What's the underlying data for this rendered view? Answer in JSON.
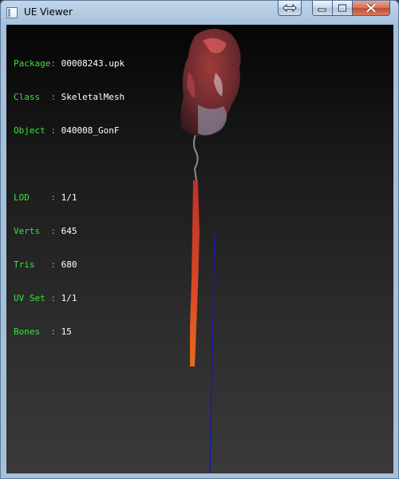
{
  "window": {
    "title": "UE Viewer",
    "icon": "app-window-icon",
    "controls": [
      "swap-icon",
      "minimize-icon",
      "maximize-icon",
      "close-icon"
    ]
  },
  "info": {
    "package_label": "Package: ",
    "package_value": "00008243.upk",
    "class_label": "Class  : ",
    "class_value": "SkeletalMesh",
    "object_label": "Object : ",
    "object_value": "040008_GonF",
    "lod_label": "LOD    : ",
    "lod_value": "1/1",
    "verts_label": "Verts  : ",
    "verts_value": "645",
    "tris_label": "Tris   : ",
    "tris_value": "680",
    "uvset_label": "UV Set : ",
    "uvset_value": "1/1",
    "bones_label": "Bones  : ",
    "bones_value": "15"
  },
  "colors": {
    "label_green": "#3ce03c",
    "value_white": "#ffffff",
    "axis_blue": "#1a1aa8"
  }
}
